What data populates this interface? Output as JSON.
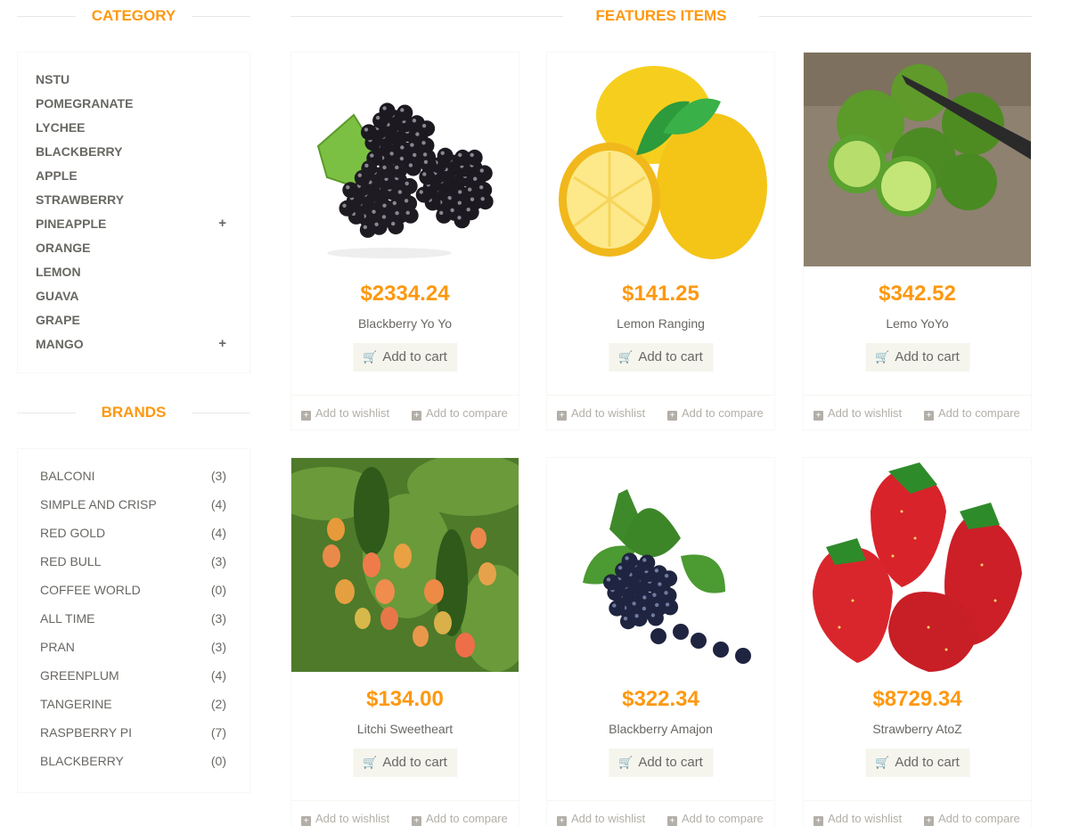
{
  "category": {
    "title": "CATEGORY",
    "items": [
      {
        "label": "NSTU",
        "expand": ""
      },
      {
        "label": "POMEGRANATE",
        "expand": ""
      },
      {
        "label": "LYCHEE",
        "expand": ""
      },
      {
        "label": "BLACKBERRY",
        "expand": ""
      },
      {
        "label": "APPLE",
        "expand": ""
      },
      {
        "label": "STRAWBERRY",
        "expand": ""
      },
      {
        "label": "PINEAPPLE",
        "expand": "+"
      },
      {
        "label": "ORANGE",
        "expand": ""
      },
      {
        "label": "LEMON",
        "expand": ""
      },
      {
        "label": "GUAVA",
        "expand": ""
      },
      {
        "label": "GRAPE",
        "expand": ""
      },
      {
        "label": "MANGO",
        "expand": "+"
      }
    ]
  },
  "brands": {
    "title": "BRANDS",
    "items": [
      {
        "label": "BALCONI",
        "count": "(3)"
      },
      {
        "label": "SIMPLE AND CRISP",
        "count": "(4)"
      },
      {
        "label": "RED GOLD",
        "count": "(4)"
      },
      {
        "label": "RED BULL",
        "count": "(3)"
      },
      {
        "label": "COFFEE WORLD",
        "count": "(0)"
      },
      {
        "label": "ALL TIME",
        "count": "(3)"
      },
      {
        "label": "PRAN",
        "count": "(3)"
      },
      {
        "label": "GREENPLUM",
        "count": "(4)"
      },
      {
        "label": "TANGERINE",
        "count": "(2)"
      },
      {
        "label": "RASPBERRY PI",
        "count": "(7)"
      },
      {
        "label": "BLACKBERRY",
        "count": "(0)"
      }
    ]
  },
  "features": {
    "title": "FEATURES ITEMS",
    "add_to_cart": "Add to cart",
    "add_to_wishlist": "Add to wishlist",
    "add_to_compare": "Add to compare",
    "products": [
      {
        "price": "$2334.24",
        "name": "Blackberry Yo Yo",
        "image": "blackberry-image"
      },
      {
        "price": "$141.25",
        "name": "Lemon Ranging",
        "image": "lemon-image"
      },
      {
        "price": "$342.52",
        "name": "Lemo YoYo",
        "image": "lime-image"
      },
      {
        "price": "$134.00",
        "name": "Litchi Sweetheart",
        "image": "mango-tree-image"
      },
      {
        "price": "$322.34",
        "name": "Blackberry Amajon",
        "image": "blueberry-image"
      },
      {
        "price": "$8729.34",
        "name": "Strawberry AtoZ",
        "image": "strawberry-image"
      }
    ]
  },
  "colors": {
    "accent": "#fe980f",
    "text": "#696763",
    "button_bg": "#f5f5ed",
    "muted": "#b3afa8"
  }
}
